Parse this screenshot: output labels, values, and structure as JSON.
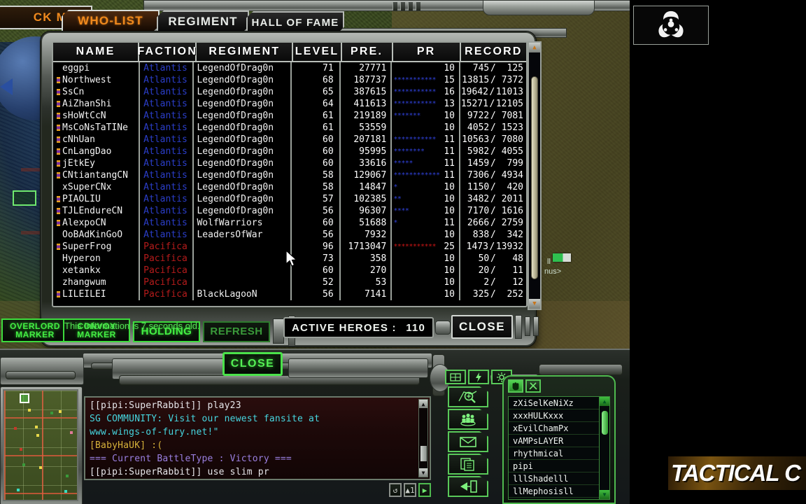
{
  "tabs": {
    "blackmap": "CK MAP",
    "items": [
      {
        "label": "WHO-LIST",
        "active": true
      },
      {
        "label": "REGIMENT",
        "active": false
      },
      {
        "label": "HALL OF FAME",
        "active": false
      }
    ]
  },
  "table": {
    "headers": [
      "NAME",
      "FACTION",
      "REGIMENT",
      "LEVEL",
      "PRE.",
      "PR",
      "RECORD"
    ],
    "rows": [
      {
        "badge": false,
        "name": "eggpi",
        "faction": "Atlantis",
        "regiment": "LegendOfDrag0n",
        "level": "71",
        "pre": "27771",
        "stars": 0,
        "pr": "10",
        "win": "745",
        "loss": "125"
      },
      {
        "badge": true,
        "name": "Northwest",
        "faction": "Atlantis",
        "regiment": "LegendOfDrag0n",
        "level": "68",
        "pre": "187737",
        "stars": 11,
        "pr": "15",
        "win": "13815",
        "loss": "7372"
      },
      {
        "badge": true,
        "name": "SsCn",
        "faction": "Atlantis",
        "regiment": "LegendOfDrag0n",
        "level": "65",
        "pre": "387615",
        "stars": 11,
        "pr": "16",
        "win": "19642",
        "loss": "11013"
      },
      {
        "badge": true,
        "name": "AiZhanShi",
        "faction": "Atlantis",
        "regiment": "LegendOfDrag0n",
        "level": "64",
        "pre": "411613",
        "stars": 11,
        "pr": "13",
        "win": "15271",
        "loss": "12105"
      },
      {
        "badge": true,
        "name": "sHoWtCcN",
        "faction": "Atlantis",
        "regiment": "LegendOfDrag0n",
        "level": "61",
        "pre": "219189",
        "stars": 7,
        "pr": "10",
        "win": "9722",
        "loss": "7081"
      },
      {
        "badge": true,
        "name": "MsCoNsTaTINe",
        "faction": "Atlantis",
        "regiment": "LegendOfDrag0n",
        "level": "61",
        "pre": "53559",
        "stars": 0,
        "pr": "10",
        "win": "4052",
        "loss": "1523"
      },
      {
        "badge": true,
        "name": "cNhUan",
        "faction": "Atlantis",
        "regiment": "LegendOfDrag0n",
        "level": "60",
        "pre": "207181",
        "stars": 11,
        "pr": "11",
        "win": "10563",
        "loss": "7080"
      },
      {
        "badge": true,
        "name": "CnLangDao",
        "faction": "Atlantis",
        "regiment": "LegendOfDrag0n",
        "level": "60",
        "pre": "95995",
        "stars": 8,
        "pr": "11",
        "win": "5982",
        "loss": "4055"
      },
      {
        "badge": true,
        "name": "jEtkEy",
        "faction": "Atlantis",
        "regiment": "LegendOfDrag0n",
        "level": "60",
        "pre": "33616",
        "stars": 5,
        "pr": "11",
        "win": "1459",
        "loss": "799"
      },
      {
        "badge": true,
        "name": "CNtiantangCN",
        "faction": "Atlantis",
        "regiment": "LegendOfDrag0n",
        "level": "58",
        "pre": "129067",
        "stars": 12,
        "pr": "11",
        "win": "7306",
        "loss": "4934"
      },
      {
        "badge": false,
        "name": "xSuperCNx",
        "faction": "Atlantis",
        "regiment": "LegendOfDrag0n",
        "level": "58",
        "pre": "14847",
        "stars": 1,
        "pr": "10",
        "win": "1150",
        "loss": "420"
      },
      {
        "badge": true,
        "name": "PIAOLIU",
        "faction": "Atlantis",
        "regiment": "LegendOfDrag0n",
        "level": "57",
        "pre": "102385",
        "stars": 2,
        "pr": "10",
        "win": "3482",
        "loss": "2011"
      },
      {
        "badge": true,
        "name": "TJLEndureCN",
        "faction": "Atlantis",
        "regiment": "LegendOfDrag0n",
        "level": "56",
        "pre": "96307",
        "stars": 4,
        "pr": "10",
        "win": "7170",
        "loss": "1616"
      },
      {
        "badge": true,
        "name": "AlexpoCN",
        "faction": "Atlantis",
        "regiment": "WolfWarriors",
        "level": "60",
        "pre": "51688",
        "stars": 1,
        "pr": "11",
        "win": "2666",
        "loss": "2759"
      },
      {
        "badge": false,
        "name": "OoBAdKinGoO",
        "faction": "Atlantis",
        "regiment": "LeadersOfWar",
        "level": "56",
        "pre": "7932",
        "stars": 0,
        "pr": "10",
        "win": "838",
        "loss": "342"
      },
      {
        "badge": true,
        "name": "SuperFrog",
        "faction": "Pacifica",
        "regiment": "",
        "level": "96",
        "pre": "1713047",
        "stars": 11,
        "pr": "25",
        "win": "1473",
        "loss": "13932"
      },
      {
        "badge": false,
        "name": "Hyperon",
        "faction": "Pacifica",
        "regiment": "",
        "level": "73",
        "pre": "358",
        "stars": 0,
        "pr": "10",
        "win": "50",
        "loss": "48"
      },
      {
        "badge": false,
        "name": "xetankx",
        "faction": "Pacifica",
        "regiment": "",
        "level": "60",
        "pre": "270",
        "stars": 0,
        "pr": "10",
        "win": "20",
        "loss": "11"
      },
      {
        "badge": false,
        "name": "zhangwum",
        "faction": "Pacifica",
        "regiment": "",
        "level": "52",
        "pre": "53",
        "stars": 0,
        "pr": "10",
        "win": "2",
        "loss": "12"
      },
      {
        "badge": true,
        "name": "LILEILEI",
        "faction": "Pacifica",
        "regiment": "BlackLagooN",
        "level": "56",
        "pre": "7141",
        "stars": 0,
        "pr": "10",
        "win": "325",
        "loss": "252"
      }
    ]
  },
  "window_footer": {
    "overlord_marker_line1": "OVERLORD",
    "overlord_marker_line2": "MARKER",
    "convoy_marker_line1": "CONVOY",
    "convoy_marker_line2": "MARKER",
    "holding": "HOLDING",
    "refresh": "REFRESH",
    "info_text": "This Information is 7 seconds old.",
    "active_heroes_label": "ACTIVE HEROES :",
    "active_heroes_value": "110",
    "close": "CLOSE"
  },
  "hud": {
    "close_button": "CLOSE"
  },
  "chat": {
    "lines": [
      {
        "text": "[[pipi:SuperRabbit]] play23",
        "color": "white"
      },
      {
        "text": "SG COMMUNITY: Visit our newest fansite at",
        "color": "cyan"
      },
      {
        "text": " www.wings-of-fury.net!\"",
        "color": "cyan"
      },
      {
        "text": "[BabyHaUK] :(",
        "color": "yellow"
      },
      {
        "text": "=== Current BattleType : Victory ===",
        "color": "purple"
      },
      {
        "text": "[[pipi:SuperRabbit]] use slim pr",
        "color": "white"
      }
    ]
  },
  "icon_column": [
    {
      "icon": "zoom-in-map-icon"
    },
    {
      "icon": "group-players-icon"
    },
    {
      "icon": "mail-icon"
    },
    {
      "icon": "clipboard-icon"
    },
    {
      "icon": "exit-door-icon"
    }
  ],
  "mini_buttons": [
    {
      "icon": "grid-icon"
    },
    {
      "icon": "lightning-icon"
    },
    {
      "icon": "gear-icon"
    }
  ],
  "player_list": {
    "tabs": [
      {
        "icon": "hand-icon",
        "active": true
      },
      {
        "icon": "crossed-swords-icon",
        "active": false
      }
    ],
    "players": [
      "zXiSelKeNiXz",
      "xxxHULKxxx",
      "xEvilChamPx",
      "vAMPsLAYER",
      "rhythmical",
      "pipi",
      "lllShadelll",
      "llMephosisll"
    ]
  },
  "overlay": {
    "biohazard_icon": "biohazard-icon",
    "watermark": "TACTICAL C"
  },
  "colors": {
    "atlantis": "#2b3ec9",
    "pacifica": "#b51b1b",
    "hud_green": "#44ee44",
    "tab_active": "#f08a1e"
  }
}
